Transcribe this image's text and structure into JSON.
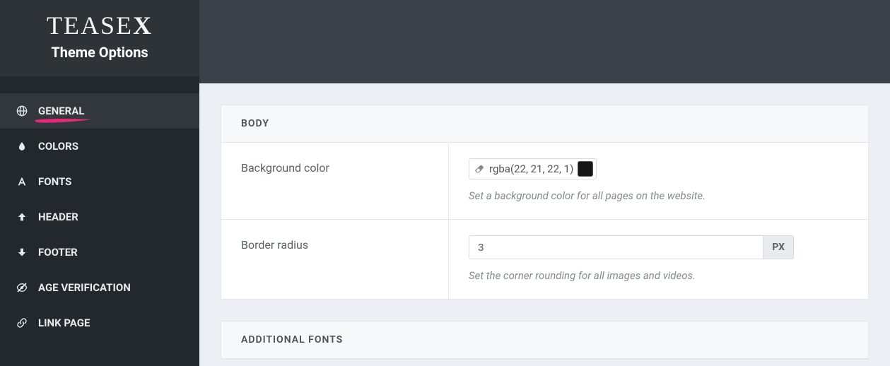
{
  "brand": {
    "logo_main": "TEASE",
    "logo_x": "X",
    "subtitle": "Theme Options"
  },
  "sidebar": {
    "items": [
      {
        "label": "GENERAL",
        "icon": "globe-icon",
        "active": true
      },
      {
        "label": "COLORS",
        "icon": "droplet-icon",
        "active": false
      },
      {
        "label": "FONTS",
        "icon": "font-icon",
        "active": false
      },
      {
        "label": "HEADER",
        "icon": "arrow-up-icon",
        "active": false
      },
      {
        "label": "FOOTER",
        "icon": "arrow-down-icon",
        "active": false
      },
      {
        "label": "AGE VERIFICATION",
        "icon": "eye-slash-icon",
        "active": false
      },
      {
        "label": "LINK PAGE",
        "icon": "link-icon",
        "active": false
      }
    ]
  },
  "panels": {
    "body": {
      "title": "BODY",
      "bg_color": {
        "label": "Background color",
        "value": "rgba(22, 21, 22, 1)",
        "swatch": "#161516",
        "help": "Set a background color for all pages on the website."
      },
      "border_radius": {
        "label": "Border radius",
        "value": "3",
        "unit": "PX",
        "help": "Set the corner rounding for all images and videos."
      }
    },
    "additional_fonts": {
      "title": "ADDITIONAL FONTS"
    }
  },
  "colors": {
    "accent": "#e6287b"
  }
}
